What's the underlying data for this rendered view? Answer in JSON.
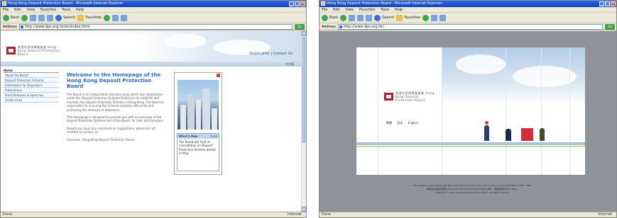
{
  "left": {
    "title": "Hong Kong Deposit Protection Board - Microsoft Internet Explorer",
    "menu": [
      "File",
      "Edit",
      "View",
      "Favorites",
      "Tools",
      "Help"
    ],
    "toolbar": {
      "back": "Back",
      "search": "Search",
      "favorites": "Favorites"
    },
    "address_label": "Address",
    "address": "http://www.dps.org.hk/en/index.html",
    "go": "Go",
    "status": "Done",
    "zone": "Internet",
    "site": {
      "logo_text": "香港存款保障委員會 Hong Kong Deposit Protection Board",
      "header_link": "Quick Links | Contact Us",
      "lang": "中文版",
      "nav_head": "Home",
      "nav": [
        "About the Board",
        "Deposit Protection Scheme",
        "Information for Depositors",
        "Publications",
        "Press Releases & Speeches",
        "Useful Links"
      ],
      "heading": "Welcome to the Homepage of the Hong Kong Deposit Protection Board",
      "paragraphs": [
        "The Board is an independent statutory body which was established under the Deposit Protection Scheme Ordinance to establish and maintain the Deposit Protection Scheme in Hong Kong. The Board is responsible for ensuring the Scheme operates efficiently and protecting the interests of depositors.",
        "This homepage is designed to provide you with an overview of the Deposit Protection Scheme and of the Board, its roles and functions.",
        "Should you have any comments or suggestions, please do not hesitate to contact us.",
        "Chairman, Hong Kong Deposit Protection Board"
      ],
      "news_head": "What's New",
      "news_more": "more",
      "news_body": "The Board will hold its consultation on Deposit Protection Scheme details in May."
    }
  },
  "right": {
    "title": "Hong Kong Deposit Protection Board - Microsoft Internet Explorer",
    "menu": [
      "File",
      "Edit",
      "View",
      "Favorites",
      "Tools",
      "Help"
    ],
    "toolbar": {
      "back": "Back",
      "search": "Search",
      "favorites": "Favorites"
    },
    "address_label": "Address",
    "address": "http://www.dps.org.hk/",
    "go": "Go",
    "status": "Done",
    "zone": "Internet",
    "site": {
      "logo_text": "香港存款保障委員會 Hong Kong Deposit Protection Board",
      "lang_links": [
        "繁體",
        "简体",
        "English"
      ],
      "footer": [
        "This website is best viewed with Microsoft Internet Explorer 5.0 or above with a screen resolution of 800 x 600.",
        "本網站最佳瀏覽效果為 Microsoft Internet Explorer 5.0 或以上版本，螢幕解像度 800 x 600。",
        "Copyright © Hong Kong Deposit Protection Board. All rights reserved."
      ]
    }
  },
  "colors": {
    "xp_blue": "#0a3fc2",
    "heading_blue": "#2b6bc7",
    "logo_red": "#b21e2a",
    "splash_grey": "#8f9299"
  }
}
